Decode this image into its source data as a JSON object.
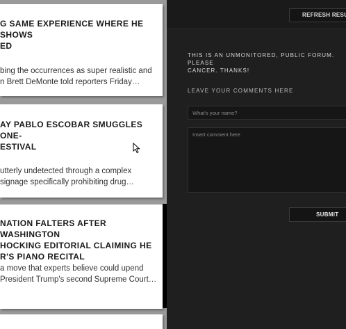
{
  "articles": [
    {
      "headline": "G SAME EXPERIENCE WHERE HE SHOWS\nED",
      "excerpt": "bing the occurrences as super realistic and\nn Brett DeMonte told reporters Friday…"
    },
    {
      "headline": "AY PABLO ESCOBAR SMUGGLES ONE-\nESTIVAL",
      "excerpt": "utterly undetected through a complex\nsignage specifically prohibiting drug…"
    },
    {
      "headline": "NATION FALTERS AFTER WASHINGTON\nHOCKING EDITORIAL CLAIMING HE\nR'S PIANO RECITAL",
      "excerpt": "a move that experts believe could upend\nPresident Trump's second Supreme Court…"
    }
  ],
  "onion_tile": {
    "icon": "onion-logo-icon"
  },
  "comments_panel": {
    "refresh_label": "REFRESH RESULTS",
    "notice": "THIS IS AN UNMONITORED, PUBLIC FORUM. PLEASE\nCANCER. THANKS!",
    "heading": "LEAVE YOUR COMMENTS HERE",
    "name_placeholder": "What's your name?",
    "comment_placeholder": "Insert comment here",
    "submit_label": "SUBMIT"
  },
  "colors": {
    "panel_bg": "#1f1f1f",
    "card_bg": "#ffffff",
    "tile_bg": "#000000"
  }
}
